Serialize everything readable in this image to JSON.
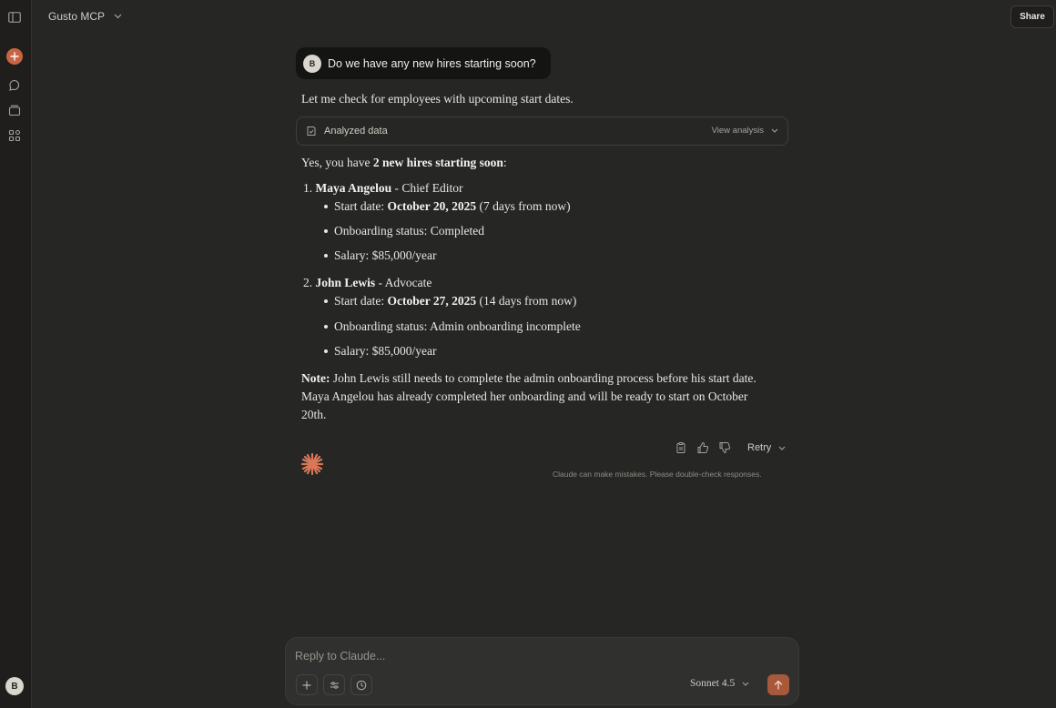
{
  "app": {
    "project_title": "Gusto MCP",
    "share_label": "Share"
  },
  "sidebar": {
    "user_initial": "B"
  },
  "conversation": {
    "user_initial": "B",
    "user_message": "Do we have any new hires starting soon?",
    "intro": "Let me check for employees with upcoming start dates.",
    "analysis": {
      "label": "Analyzed data",
      "view_label": "View analysis"
    },
    "summary_prefix": "Yes, you have ",
    "summary_bold": "2 new hires starting soon",
    "summary_suffix": ":",
    "hires": [
      {
        "num": "1.",
        "name": "Maya Angelou",
        "role": " - Chief Editor",
        "start_prefix": "Start date: ",
        "start_date": "October 20, 2025",
        "start_suffix": " (7 days from now)",
        "onboarding": "Onboarding status: Completed",
        "salary": "Salary: $85,000/year"
      },
      {
        "num": "2.",
        "name": "John Lewis",
        "role": " - Advocate",
        "start_prefix": "Start date: ",
        "start_date": "October 27, 2025",
        "start_suffix": " (14 days from now)",
        "onboarding": "Onboarding status: Admin onboarding incomplete",
        "salary": "Salary: $85,000/year"
      }
    ],
    "note_label": "Note:",
    "note_line1": " John Lewis still needs to complete the admin onboarding process before his start date.",
    "note_line2": "Maya Angelou has already completed her onboarding and will be ready to start on October",
    "note_line3": "20th.",
    "retry_label": "Retry",
    "disclaimer": "Claude can make mistakes. Please double-check responses."
  },
  "composer": {
    "placeholder": "Reply to Claude...",
    "model": "Sonnet 4.5"
  },
  "colors": {
    "accent": "#c96442",
    "send": "#a8583b",
    "background": "#262624"
  }
}
